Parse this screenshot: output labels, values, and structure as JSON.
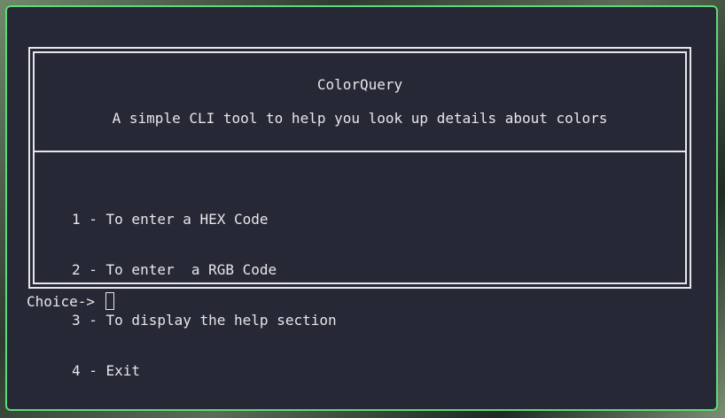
{
  "app": {
    "title": "ColorQuery",
    "subtitle": "A simple CLI tool to help you look up details about colors"
  },
  "menu": {
    "items": [
      "1 - To enter a HEX Code",
      "2 - To enter  a RGB Code",
      "3 - To display the help section",
      "4 - Exit"
    ]
  },
  "prompt": {
    "label": "Choice-> ",
    "input_value": ""
  },
  "colors": {
    "terminal_bg": "#262836",
    "window_border": "#5fd97a",
    "text": "#e6e6ea"
  }
}
